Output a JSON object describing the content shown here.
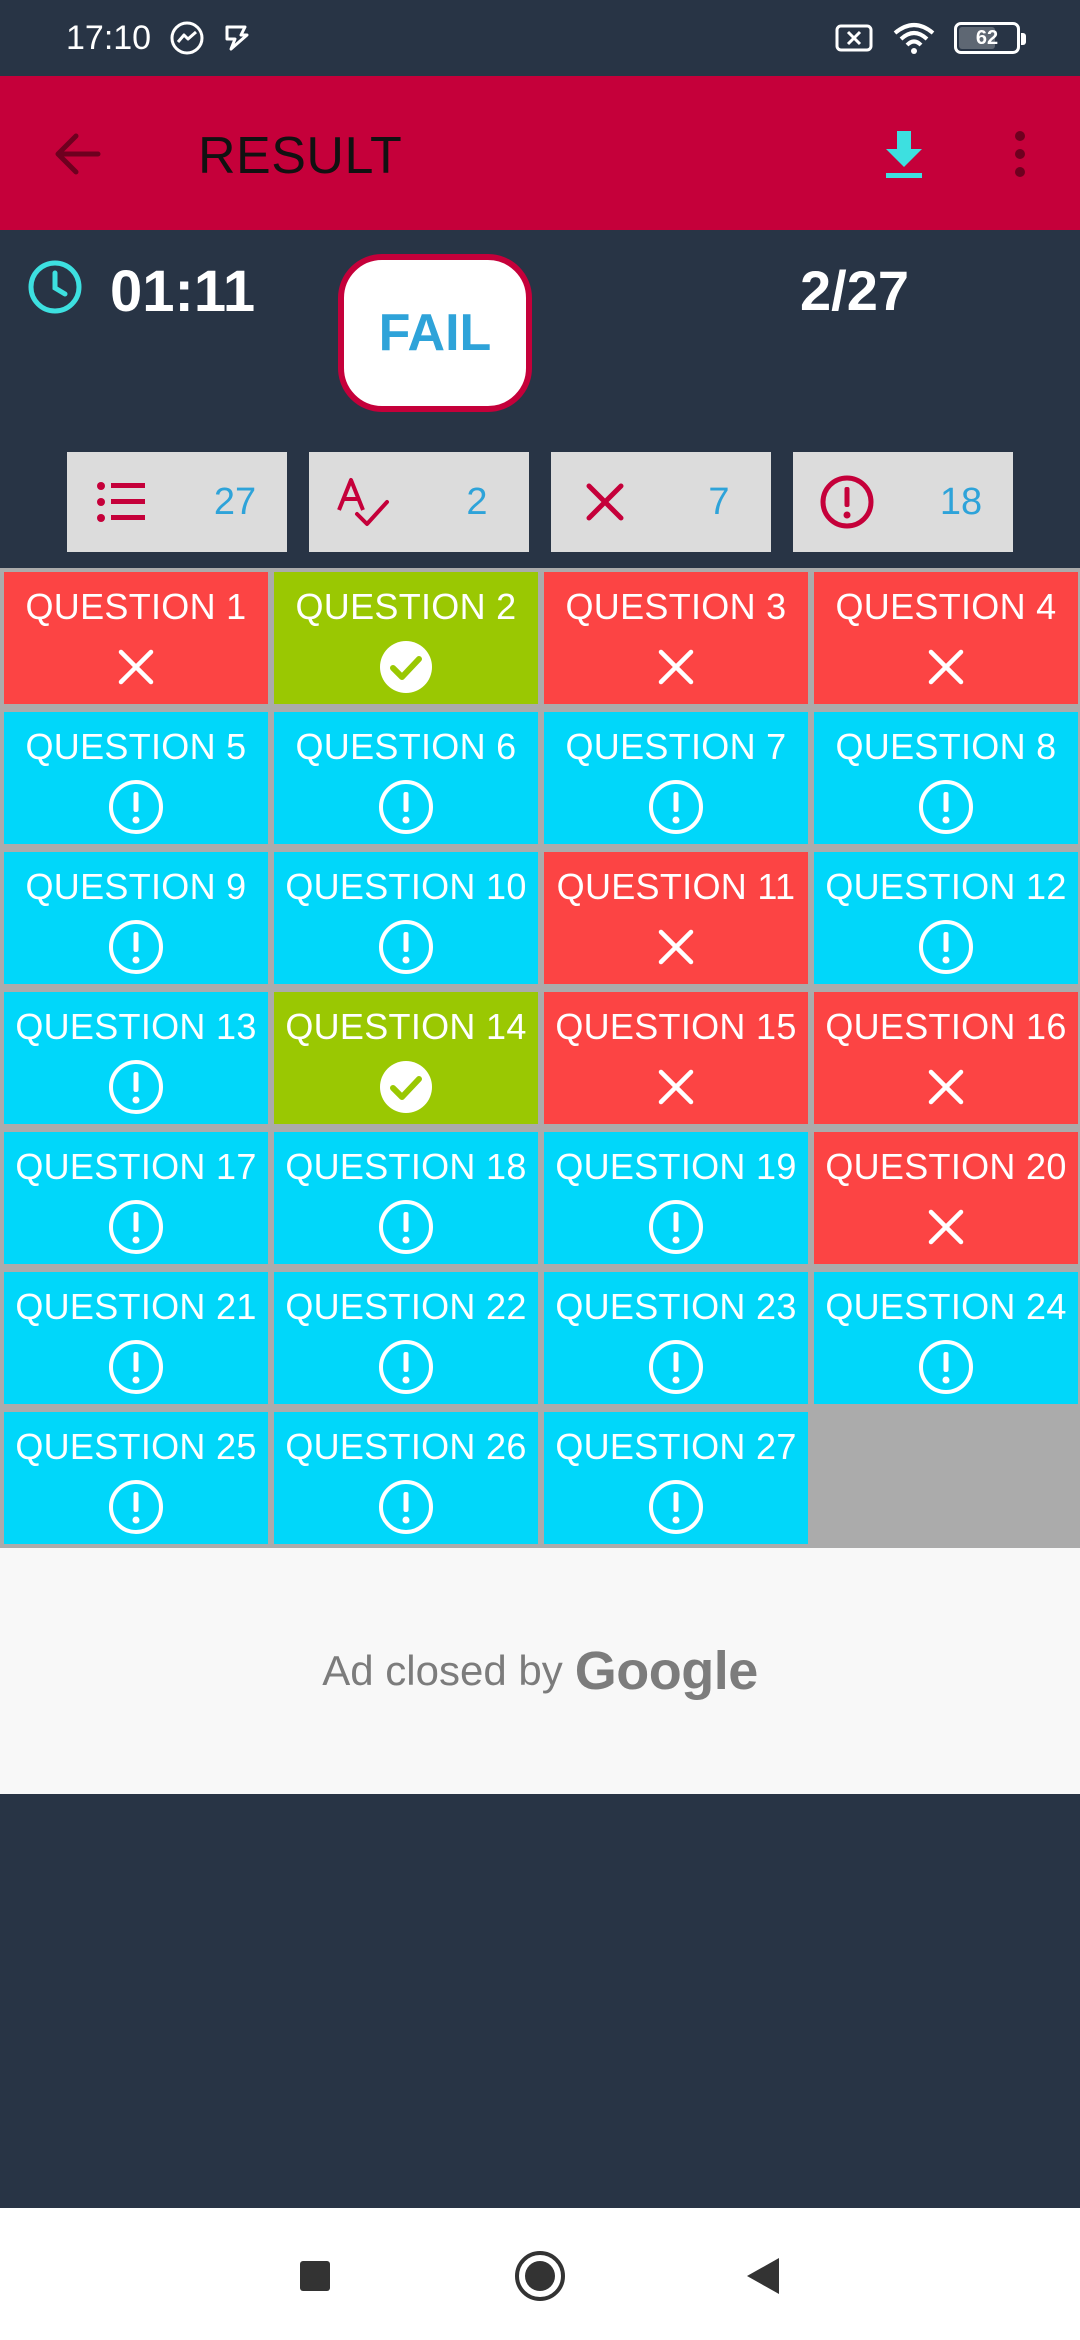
{
  "status_bar": {
    "time": "17:10",
    "battery_level": "62",
    "icons": [
      "messenger-icon",
      "app-notification-icon",
      "no-sim-icon",
      "wifi-icon",
      "battery-icon"
    ]
  },
  "app_bar": {
    "title": "RESULT",
    "icons": [
      "back-arrow-icon",
      "download-icon",
      "more-vertical-icon"
    ]
  },
  "summary": {
    "timer": "01:11",
    "status": "FAIL",
    "score": "2/27"
  },
  "filters": {
    "all_count": "27",
    "correct_count": "2",
    "wrong_count": "7",
    "unanswered_count": "18"
  },
  "questions": [
    {
      "label": "QUESTION 1",
      "status": "wrong"
    },
    {
      "label": "QUESTION 2",
      "status": "correct"
    },
    {
      "label": "QUESTION 3",
      "status": "wrong"
    },
    {
      "label": "QUESTION 4",
      "status": "wrong"
    },
    {
      "label": "QUESTION 5",
      "status": "unanswered"
    },
    {
      "label": "QUESTION 6",
      "status": "unanswered"
    },
    {
      "label": "QUESTION 7",
      "status": "unanswered"
    },
    {
      "label": "QUESTION 8",
      "status": "unanswered"
    },
    {
      "label": "QUESTION 9",
      "status": "unanswered"
    },
    {
      "label": "QUESTION 10",
      "status": "unanswered"
    },
    {
      "label": "QUESTION 11",
      "status": "wrong"
    },
    {
      "label": "QUESTION 12",
      "status": "unanswered"
    },
    {
      "label": "QUESTION 13",
      "status": "unanswered"
    },
    {
      "label": "QUESTION 14",
      "status": "correct"
    },
    {
      "label": "QUESTION 15",
      "status": "wrong"
    },
    {
      "label": "QUESTION 16",
      "status": "wrong"
    },
    {
      "label": "QUESTION 17",
      "status": "unanswered"
    },
    {
      "label": "QUESTION 18",
      "status": "unanswered"
    },
    {
      "label": "QUESTION 19",
      "status": "unanswered"
    },
    {
      "label": "QUESTION 20",
      "status": "wrong"
    },
    {
      "label": "QUESTION 21",
      "status": "unanswered"
    },
    {
      "label": "QUESTION 22",
      "status": "unanswered"
    },
    {
      "label": "QUESTION 23",
      "status": "unanswered"
    },
    {
      "label": "QUESTION 24",
      "status": "unanswered"
    },
    {
      "label": "QUESTION 25",
      "status": "unanswered"
    },
    {
      "label": "QUESTION 26",
      "status": "unanswered"
    },
    {
      "label": "QUESTION 27",
      "status": "unanswered"
    }
  ],
  "ad": {
    "text": "Ad closed by",
    "brand": "Google"
  },
  "colors": {
    "app_bar": "#c5003a",
    "background": "#283445",
    "wrong": "#fc4444",
    "correct": "#9ac802",
    "unanswered": "#00d7fa",
    "accent": "#2ea3d9",
    "download_icon": "#3de0e0",
    "clock_icon": "#3de0e0"
  },
  "nav_bar": {
    "icons": [
      "recents-square-icon",
      "home-circle-icon",
      "back-triangle-icon"
    ]
  }
}
